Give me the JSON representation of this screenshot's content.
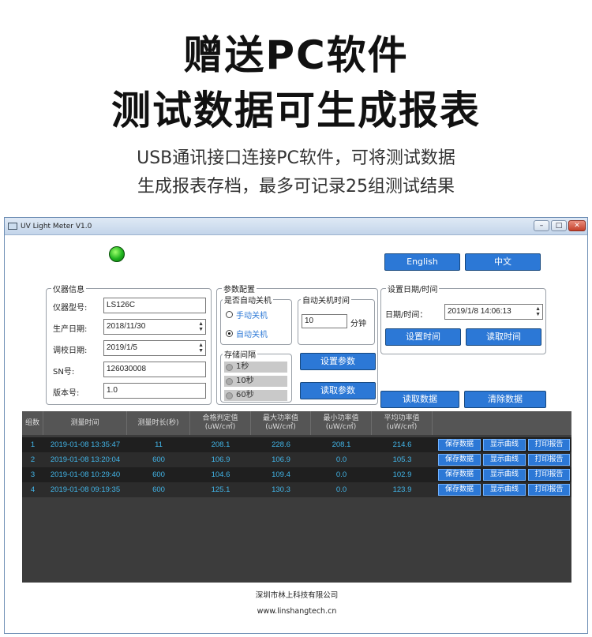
{
  "headline": {
    "line1": "赠送PC软件",
    "line2": "测试数据可生成报表"
  },
  "subtitle": {
    "line1": "USB通讯接口连接PC软件，可将测试数据",
    "line2": "生成报表存档，最多可记录25组测试结果"
  },
  "window": {
    "title": "UV Light Meter V1.0",
    "controls": {
      "minimize": "–",
      "maximize": "□",
      "close": "✕"
    },
    "led_color": "#1fb31f"
  },
  "lang": {
    "english": "English",
    "chinese": "中文"
  },
  "device": {
    "legend": "仪器信息",
    "model_label": "仪器型号:",
    "model": "LS126C",
    "prod_label": "生产日期:",
    "prod": "2018/11/30",
    "cal_label": "调校日期:",
    "cal": "2019/1/5",
    "sn_label": "SN号:",
    "sn": "126030008",
    "ver_label": "版本号:",
    "ver": "1.0"
  },
  "params": {
    "legend": "参数配置",
    "autooff_legend": "是否自动关机",
    "manual": "手动关机",
    "auto": "自动关机",
    "time_legend": "自动关机时间",
    "time_value": "10",
    "time_unit": "分钟",
    "interval_legend": "存储间隔",
    "i1": "1秒",
    "i2": "10秒",
    "i3": "60秒",
    "set_btn": "设置参数",
    "read_btn": "读取参数"
  },
  "datetime": {
    "legend": "设置日期/时间",
    "label": "日期/时间：",
    "value": "2019/1/8 14:06:13",
    "set_btn": "设置时间",
    "read_btn": "读取时间"
  },
  "actions": {
    "read_data": "读取数据",
    "clear_data": "清除数据"
  },
  "table": {
    "headers": [
      "组数",
      "测量时间",
      "测量时长(秒)",
      "合格判定值\n(uW/c㎡)",
      "最大功率值\n(uW/c㎡)",
      "最小功率值\n(uW/c㎡)",
      "平均功率值\n(uW/c㎡)"
    ],
    "rows": [
      {
        "n": "1",
        "time": "2019-01-08 13:35:47",
        "dur": "11",
        "pass": "208.1",
        "max": "228.6",
        "min": "208.1",
        "avg": "214.6"
      },
      {
        "n": "2",
        "time": "2019-01-08 13:20:04",
        "dur": "600",
        "pass": "106.9",
        "max": "106.9",
        "min": "0.0",
        "avg": "105.3"
      },
      {
        "n": "3",
        "time": "2019-01-08 10:29:40",
        "dur": "600",
        "pass": "104.6",
        "max": "109.4",
        "min": "0.0",
        "avg": "102.9"
      },
      {
        "n": "4",
        "time": "2019-01-08 09:19:35",
        "dur": "600",
        "pass": "125.1",
        "max": "130.3",
        "min": "0.0",
        "avg": "123.9"
      }
    ],
    "row_actions": {
      "save": "保存数据",
      "curve": "显示曲线",
      "print": "打印报告"
    }
  },
  "footer": {
    "company": "深圳市林上科技有限公司",
    "url": "www.linshangtech.cn"
  }
}
